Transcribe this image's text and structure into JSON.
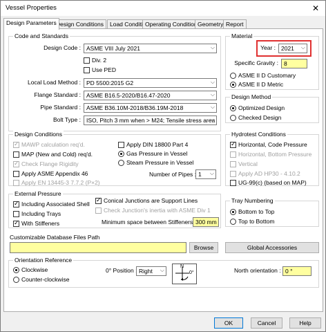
{
  "window": {
    "title": "Vessel Properties",
    "close_symbol": "✕"
  },
  "tabs": [
    "Design Parameters",
    "Design Conditions",
    "Load Conditions",
    "Operating Conditions",
    "Geometry",
    "Report"
  ],
  "code_standards": {
    "title": "Code and Standards",
    "design_code_label": "Design Code :",
    "design_code_value": "ASME VIII July 2021",
    "div2_label": "Div. 2",
    "useped_label": "Use PED",
    "local_load_label": "Local Load Method :",
    "local_load_value": "PD 5500:2015 G2",
    "flange_label": "Flange Standard :",
    "flange_value": "ASME B16.5-2020/B16.47-2020",
    "pipe_label": "Pipe Standard :",
    "pipe_value": "ASME B36.10M-2018/B36.19M-2018",
    "bolt_label": "Bolt Type :",
    "bolt_value": "ISO, Pitch 3 mm when > M24; Tensile stress area"
  },
  "material": {
    "title": "Material",
    "year_label": "Year :",
    "year_value": "2021",
    "specific_gravity_label": "Specific Gravity :",
    "specific_gravity_value": "8",
    "customary_label": "ASME II D Customary",
    "metric_label": "ASME II D Metric"
  },
  "design_method": {
    "title": "Design Method",
    "optimized_label": "Optimized Design",
    "checked_label": "Checked Design"
  },
  "design_conditions": {
    "title": "Design Conditions",
    "mawp_label": "MAWP calculation req'd.",
    "map_label": "MAP (New and Cold) req'd.",
    "flange_rigidity_label": "Check Flange Rigidity",
    "appendix46_label": "Apply ASME Appendix 46",
    "en13445_label": "Apply EN 13445-3 7.7.2 (P×2)",
    "din18800_label": "Apply DIN 18800 Part 4",
    "gas_pressure_label": "Gas Pressure in Vessel",
    "steam_pressure_label": "Steam Pressure in Vessel",
    "num_pipes_label": "Number of Pipes :",
    "num_pipes_value": "1"
  },
  "hydrotest": {
    "title": "Hydrotest Conditions",
    "horizontal_code_label": "Horizontal, Code Pressure",
    "horizontal_bottom_label": "Horizontal, Bottom Pressure",
    "vertical_label": "Vertical",
    "ad_hp30_label": "Apply AD HP30 - 4.10.2",
    "ug99_label": "UG-99(c) (based on MAP)"
  },
  "external_pressure": {
    "title": "External Pressure",
    "assoc_shell_label": "Including Associated Shell",
    "trays_label": "Including Trays",
    "stiffeners_label": "With Stiffeners",
    "conical_label": "Conical Junctions are Support Lines",
    "inertia_label": "Check Junction's inertia with ASME Div 1",
    "min_space_label": "Minimum space between Stiffeners :",
    "min_space_value": "300 mm"
  },
  "tray_numbering": {
    "title": "Tray Numbering",
    "bottom_top_label": "Bottom to Top",
    "top_bottom_label": "Top to Bottom"
  },
  "database": {
    "title": "Customizable Database Files Path",
    "path_value": "",
    "browse_label": "Browse",
    "global_label": "Global Accessories"
  },
  "orientation": {
    "title": "Orientation Reference",
    "clockwise_label": "Clockwise",
    "counter_label": "Counter-clockwise",
    "position_label": "0° Position :",
    "position_value": "Right",
    "north_label": "North orientation :",
    "north_value": "0 °",
    "compass_n": "N",
    "compass_0": "0°"
  },
  "footer": {
    "ok_label": "OK",
    "cancel_label": "Cancel",
    "help_label": "Help"
  }
}
